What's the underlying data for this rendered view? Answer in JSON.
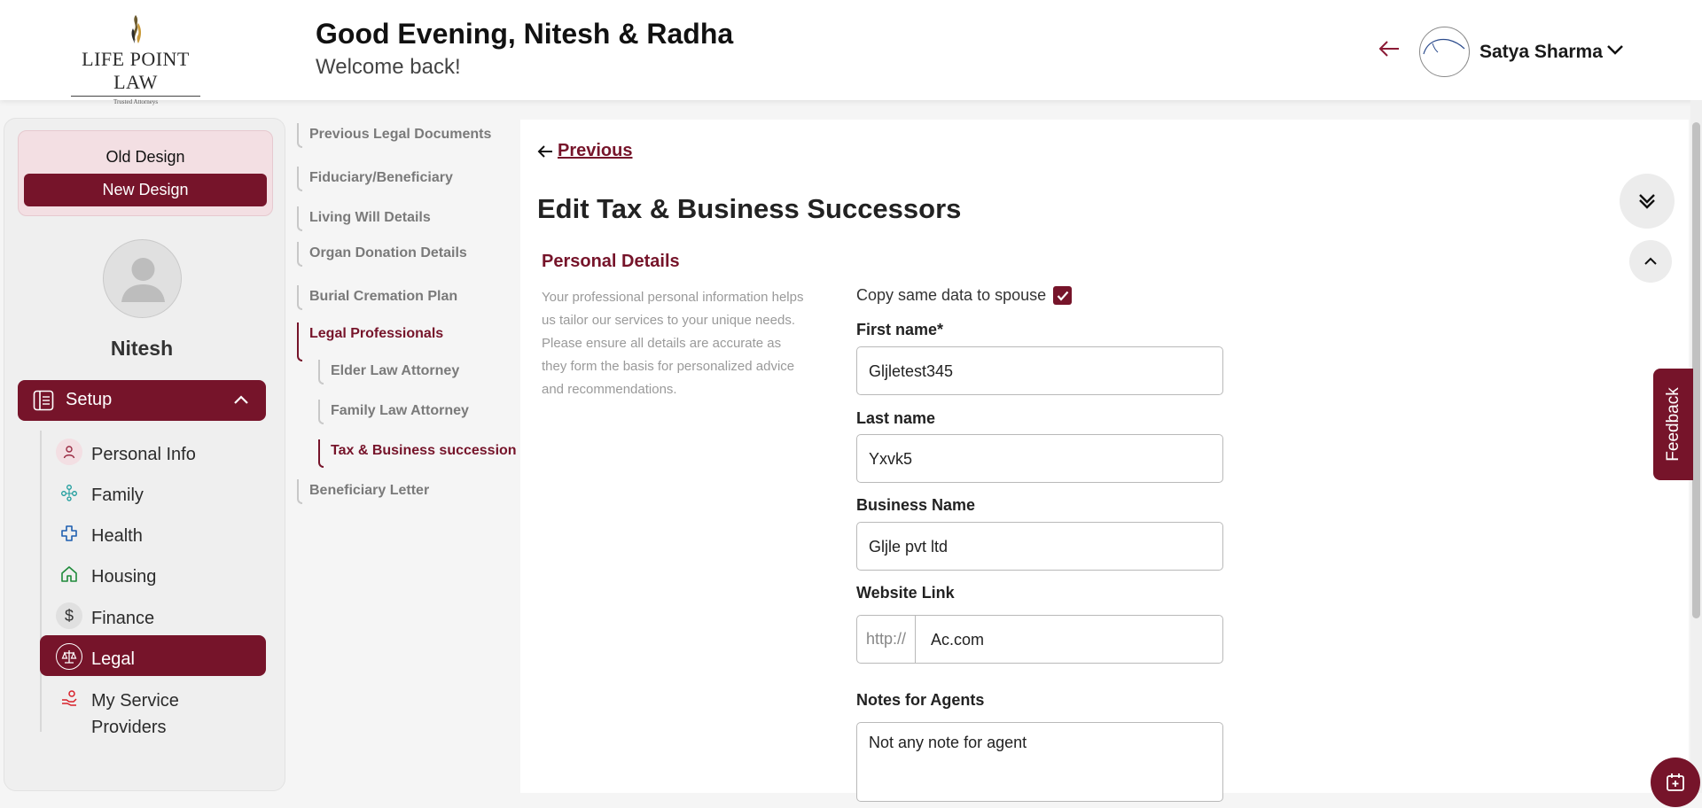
{
  "brand": {
    "name": "LIFE POINT LAW",
    "tagline": "Trusted Attorneys"
  },
  "header": {
    "greeting": "Good Evening, Nitesh & Radha",
    "welcome": "Welcome back!",
    "user_name": "Satya Sharma"
  },
  "sidebar": {
    "old_design": "Old Design",
    "new_design": "New Design",
    "profile_name": "Nitesh",
    "setup": "Setup",
    "items": [
      {
        "label": "Personal Info",
        "icon": "person-icon"
      },
      {
        "label": "Family",
        "icon": "family-icon"
      },
      {
        "label": "Health",
        "icon": "health-cross-icon"
      },
      {
        "label": "Housing",
        "icon": "home-icon"
      },
      {
        "label": "Finance",
        "icon": "dollar-icon"
      },
      {
        "label": "Legal",
        "icon": "scales-icon",
        "active": true
      },
      {
        "label": "My Service Providers",
        "icon": "hand-service-icon"
      }
    ]
  },
  "subnav": {
    "items": [
      "Previous Legal Documents",
      "Fiduciary/Beneficiary",
      "Living Will Details",
      "Organ Donation Details",
      "Burial Cremation Plan",
      "Legal Professionals",
      "Elder Law Attorney",
      "Family Law Attorney",
      "Tax & Business succession",
      "Beneficiary Letter"
    ]
  },
  "main": {
    "previous": "Previous",
    "title": "Edit Tax & Business Successors",
    "section_title": "Personal Details",
    "section_desc": "Your professional personal information helps us tailor our services to your unique needs. Please ensure all details are accurate as they form the basis for personalized advice and recommendations.",
    "copy_to_spouse": "Copy same data to spouse",
    "copy_checked": true,
    "fields": {
      "first_name_label": "First name*",
      "first_name": "Gljletest345",
      "last_name_label": "Last name",
      "last_name": "Yxvk5",
      "business_label": "Business Name",
      "business": "Gljle pvt ltd",
      "website_label": "Website Link",
      "website_prefix": "http://",
      "website": "Ac.com",
      "notes_label": "Notes for Agents",
      "notes": "Not any note for agent"
    }
  },
  "feedback": "Feedback",
  "colors": {
    "accent": "#76142a"
  }
}
